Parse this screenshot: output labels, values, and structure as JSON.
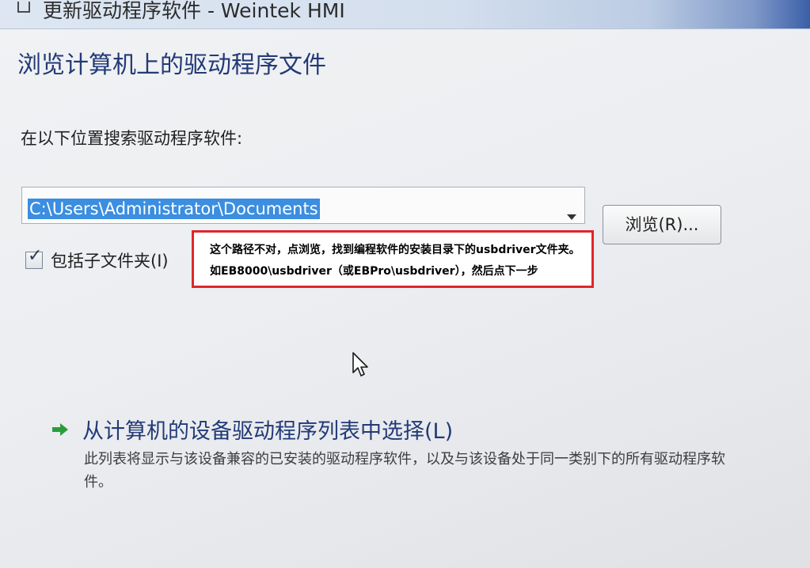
{
  "window": {
    "title": "更新驱动程序软件 - Weintek HMI"
  },
  "page": {
    "heading": "浏览计算机上的驱动程序文件",
    "search_label": "在以下位置搜索驱动程序软件:",
    "path_value": "C:\\Users\\Administrator\\Documents",
    "browse_label": "浏览(R)...",
    "include_subfolders_label": "包括子文件夹(I)",
    "include_subfolders_checked": true
  },
  "annotation": {
    "line1": "这个路径不对，点浏览，找到编程软件的安装目录下的usbdriver文件夹。",
    "line2": "如EB8000\\usbdriver（或EBPro\\usbdriver），然后点下一步",
    "border_color": "#e0262a"
  },
  "option": {
    "title": "从计算机的设备驱动程序列表中选择(L)",
    "description": "此列表将显示与该设备兼容的已安装的驱动程序软件，以及与该设备处于同一类别下的所有驱动程序软件。",
    "arrow_color": "#2a9d3a"
  },
  "colors": {
    "heading": "#223a77",
    "selection": "#3b8ee0"
  },
  "icons": {
    "title": "window-icon",
    "checkbox": "check-icon",
    "option": "green-arrow-icon",
    "cursor": "mouse-cursor-icon"
  }
}
